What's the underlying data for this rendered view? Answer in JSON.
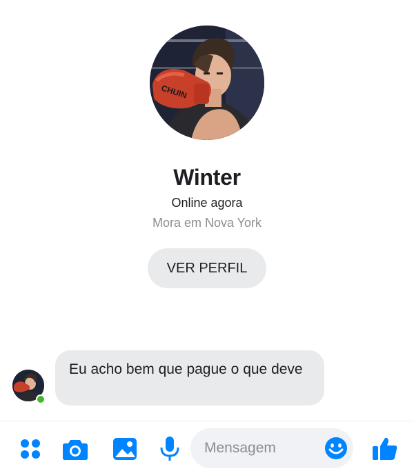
{
  "contact": {
    "name": "Winter",
    "status": "Online agora",
    "location": "Mora em Nova York",
    "view_profile_label": "VER PERFIL",
    "glove_text": "CHUIN"
  },
  "messages": [
    {
      "sender": "Winter",
      "text": "Eu acho bem que pague o que deve"
    }
  ],
  "composer": {
    "placeholder": "Mensagem",
    "icons": [
      "apps-icon",
      "camera-icon",
      "gallery-icon",
      "microphone-icon",
      "emoji-icon",
      "thumbs-up-icon"
    ]
  },
  "colors": {
    "accent": "#0084ff",
    "online": "#42b72a",
    "bubble": "#e9eaec",
    "muted_text": "#8a8d91"
  }
}
